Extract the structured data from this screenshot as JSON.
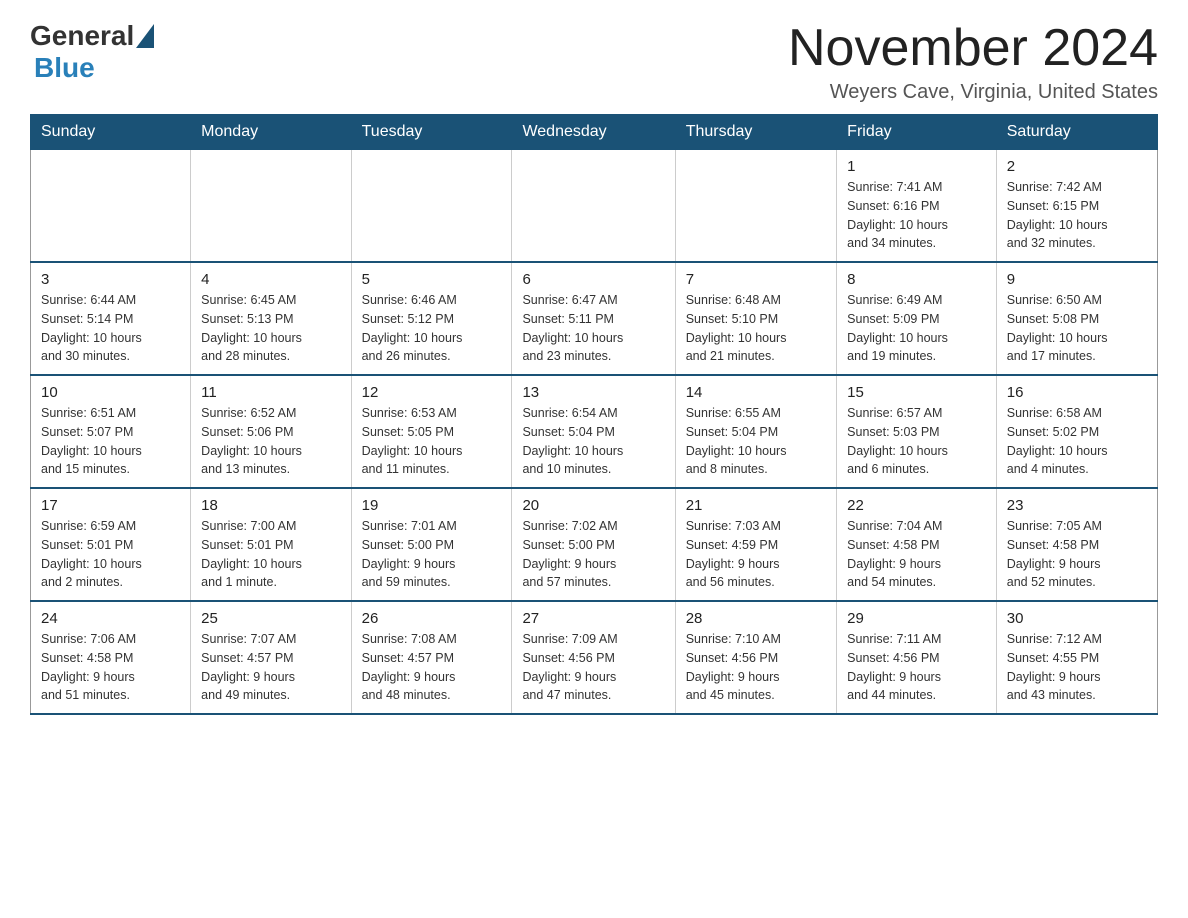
{
  "header": {
    "title": "November 2024",
    "location": "Weyers Cave, Virginia, United States",
    "logo_general": "General",
    "logo_blue": "Blue"
  },
  "days_of_week": [
    "Sunday",
    "Monday",
    "Tuesday",
    "Wednesday",
    "Thursday",
    "Friday",
    "Saturday"
  ],
  "weeks": [
    {
      "days": [
        {
          "num": "",
          "info": ""
        },
        {
          "num": "",
          "info": ""
        },
        {
          "num": "",
          "info": ""
        },
        {
          "num": "",
          "info": ""
        },
        {
          "num": "",
          "info": ""
        },
        {
          "num": "1",
          "info": "Sunrise: 7:41 AM\nSunset: 6:16 PM\nDaylight: 10 hours\nand 34 minutes."
        },
        {
          "num": "2",
          "info": "Sunrise: 7:42 AM\nSunset: 6:15 PM\nDaylight: 10 hours\nand 32 minutes."
        }
      ]
    },
    {
      "days": [
        {
          "num": "3",
          "info": "Sunrise: 6:44 AM\nSunset: 5:14 PM\nDaylight: 10 hours\nand 30 minutes."
        },
        {
          "num": "4",
          "info": "Sunrise: 6:45 AM\nSunset: 5:13 PM\nDaylight: 10 hours\nand 28 minutes."
        },
        {
          "num": "5",
          "info": "Sunrise: 6:46 AM\nSunset: 5:12 PM\nDaylight: 10 hours\nand 26 minutes."
        },
        {
          "num": "6",
          "info": "Sunrise: 6:47 AM\nSunset: 5:11 PM\nDaylight: 10 hours\nand 23 minutes."
        },
        {
          "num": "7",
          "info": "Sunrise: 6:48 AM\nSunset: 5:10 PM\nDaylight: 10 hours\nand 21 minutes."
        },
        {
          "num": "8",
          "info": "Sunrise: 6:49 AM\nSunset: 5:09 PM\nDaylight: 10 hours\nand 19 minutes."
        },
        {
          "num": "9",
          "info": "Sunrise: 6:50 AM\nSunset: 5:08 PM\nDaylight: 10 hours\nand 17 minutes."
        }
      ]
    },
    {
      "days": [
        {
          "num": "10",
          "info": "Sunrise: 6:51 AM\nSunset: 5:07 PM\nDaylight: 10 hours\nand 15 minutes."
        },
        {
          "num": "11",
          "info": "Sunrise: 6:52 AM\nSunset: 5:06 PM\nDaylight: 10 hours\nand 13 minutes."
        },
        {
          "num": "12",
          "info": "Sunrise: 6:53 AM\nSunset: 5:05 PM\nDaylight: 10 hours\nand 11 minutes."
        },
        {
          "num": "13",
          "info": "Sunrise: 6:54 AM\nSunset: 5:04 PM\nDaylight: 10 hours\nand 10 minutes."
        },
        {
          "num": "14",
          "info": "Sunrise: 6:55 AM\nSunset: 5:04 PM\nDaylight: 10 hours\nand 8 minutes."
        },
        {
          "num": "15",
          "info": "Sunrise: 6:57 AM\nSunset: 5:03 PM\nDaylight: 10 hours\nand 6 minutes."
        },
        {
          "num": "16",
          "info": "Sunrise: 6:58 AM\nSunset: 5:02 PM\nDaylight: 10 hours\nand 4 minutes."
        }
      ]
    },
    {
      "days": [
        {
          "num": "17",
          "info": "Sunrise: 6:59 AM\nSunset: 5:01 PM\nDaylight: 10 hours\nand 2 minutes."
        },
        {
          "num": "18",
          "info": "Sunrise: 7:00 AM\nSunset: 5:01 PM\nDaylight: 10 hours\nand 1 minute."
        },
        {
          "num": "19",
          "info": "Sunrise: 7:01 AM\nSunset: 5:00 PM\nDaylight: 9 hours\nand 59 minutes."
        },
        {
          "num": "20",
          "info": "Sunrise: 7:02 AM\nSunset: 5:00 PM\nDaylight: 9 hours\nand 57 minutes."
        },
        {
          "num": "21",
          "info": "Sunrise: 7:03 AM\nSunset: 4:59 PM\nDaylight: 9 hours\nand 56 minutes."
        },
        {
          "num": "22",
          "info": "Sunrise: 7:04 AM\nSunset: 4:58 PM\nDaylight: 9 hours\nand 54 minutes."
        },
        {
          "num": "23",
          "info": "Sunrise: 7:05 AM\nSunset: 4:58 PM\nDaylight: 9 hours\nand 52 minutes."
        }
      ]
    },
    {
      "days": [
        {
          "num": "24",
          "info": "Sunrise: 7:06 AM\nSunset: 4:58 PM\nDaylight: 9 hours\nand 51 minutes."
        },
        {
          "num": "25",
          "info": "Sunrise: 7:07 AM\nSunset: 4:57 PM\nDaylight: 9 hours\nand 49 minutes."
        },
        {
          "num": "26",
          "info": "Sunrise: 7:08 AM\nSunset: 4:57 PM\nDaylight: 9 hours\nand 48 minutes."
        },
        {
          "num": "27",
          "info": "Sunrise: 7:09 AM\nSunset: 4:56 PM\nDaylight: 9 hours\nand 47 minutes."
        },
        {
          "num": "28",
          "info": "Sunrise: 7:10 AM\nSunset: 4:56 PM\nDaylight: 9 hours\nand 45 minutes."
        },
        {
          "num": "29",
          "info": "Sunrise: 7:11 AM\nSunset: 4:56 PM\nDaylight: 9 hours\nand 44 minutes."
        },
        {
          "num": "30",
          "info": "Sunrise: 7:12 AM\nSunset: 4:55 PM\nDaylight: 9 hours\nand 43 minutes."
        }
      ]
    }
  ]
}
